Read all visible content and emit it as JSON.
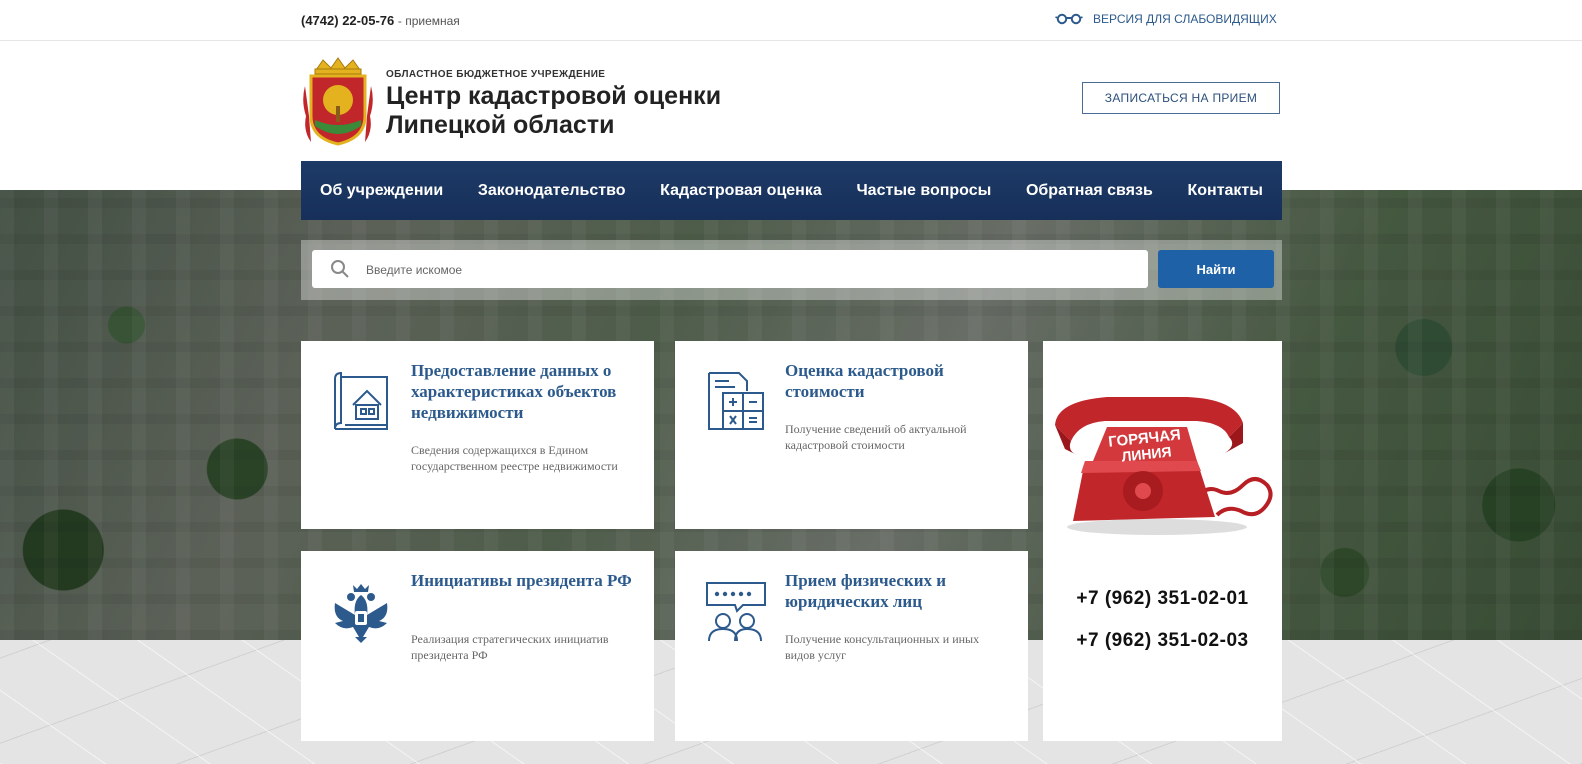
{
  "topbar": {
    "phone": "(4742) 22-05-76",
    "phone_note": "- приемная",
    "vision_icon": "glasses-icon",
    "vision_label": "ВЕРСИЯ ДЛЯ СЛАБОВИДЯЩИХ"
  },
  "header": {
    "logo_icon": "coat-of-arms-icon",
    "org_sub": "ОБЛАСТНОЕ БЮДЖЕТНОЕ УЧРЕЖДЕНИЕ",
    "org_title_line1": "Центр кадастровой оценки",
    "org_title_line2": "Липецкой области",
    "appoint_button": "ЗАПИСАТЬСЯ НА ПРИЕМ"
  },
  "nav": {
    "items": [
      {
        "label": "Об учреждении"
      },
      {
        "label": "Законодательство"
      },
      {
        "label": "Кадастровая оценка"
      },
      {
        "label": "Частые вопросы"
      },
      {
        "label": "Обратная связь"
      },
      {
        "label": "Контакты"
      }
    ]
  },
  "search": {
    "placeholder": "Введите искомое",
    "button": "Найти",
    "icon": "search-icon"
  },
  "cards": [
    {
      "icon": "property-plan-icon",
      "title": "Предоставление данных о характеристиках объектов недвижимости",
      "desc": "Сведения содержащихся в Едином государственном реестре недвижимости"
    },
    {
      "icon": "calculator-document-icon",
      "title": "Оценка кадастровой стоимости",
      "desc": "Получение сведений об актуальной кадастровой стоимости"
    },
    {
      "icon": "double-headed-eagle-icon",
      "title": "Инициативы президента РФ",
      "desc": "Реализация стратегических инициатив президента РФ"
    },
    {
      "icon": "consultation-people-icon",
      "title": "Прием физических и юридических лиц",
      "desc": "Получение консультационных и иных видов услуг"
    }
  ],
  "hotline": {
    "image_icon": "red-telephone-icon",
    "image_text_line1": "ГОРЯЧАЯ",
    "image_text_line2": "ЛИНИЯ",
    "phone1": "+7 (962) 351-02-01",
    "phone2": "+7 (962) 351-02-03"
  },
  "colors": {
    "nav_bg": "#1d3a66",
    "accent_blue": "#2c5a8c",
    "button_blue": "#1f61a6",
    "hotline_red": "#c0262a"
  }
}
